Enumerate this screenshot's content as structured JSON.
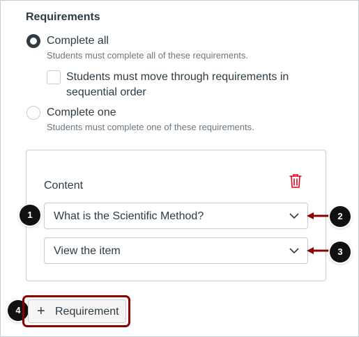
{
  "requirements": {
    "heading": "Requirements",
    "complete_all": {
      "label": "Complete all",
      "description": "Students must complete all of these requirements.",
      "selected": true
    },
    "sequential": {
      "label": "Students must move through requirements in sequential order",
      "checked": false
    },
    "complete_one": {
      "label": "Complete one",
      "description": "Students must complete one of these requirements.",
      "selected": false
    }
  },
  "content": {
    "label": "Content",
    "item_select": {
      "value": "What is the Scientific Method?"
    },
    "requirement_select": {
      "value": "View the item"
    },
    "delete_icon": "trash-icon"
  },
  "add_requirement": {
    "label": "Requirement",
    "icon": "plus-icon"
  },
  "callouts": [
    "1",
    "2",
    "3",
    "4"
  ],
  "colors": {
    "callout_arrow": "#8b0000",
    "trash": "#e0061f",
    "text": "#2d3b45"
  }
}
